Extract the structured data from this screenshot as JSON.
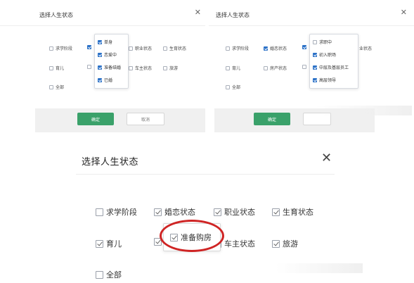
{
  "left_panel": {
    "title": "选择人生状态",
    "close_glyph": "✕",
    "options": {
      "study": "求学阶段",
      "career": "职业状态",
      "fertility": "生育状态",
      "parenting": "育儿",
      "car": "车主状态",
      "travel": "旅游",
      "all": "全部"
    },
    "dropdown": {
      "items": [
        "单身",
        "恋爱中",
        "准备结婚",
        "已婚"
      ]
    },
    "confirm_label": "确定",
    "cancel_label": "取消"
  },
  "right_panel": {
    "title": "选择人生状态",
    "close_glyph": "✕",
    "options": {
      "study": "求学阶段",
      "marriage": "婚恋状态",
      "career_trunc": "业状态",
      "parenting": "育儿",
      "property": "房产状态",
      "all": "全部"
    },
    "dropdown": {
      "items": [
        "求职中",
        "初入职场",
        "中层及基层员工",
        "高层领导"
      ]
    },
    "confirm_label": "确定"
  },
  "bottom_panel": {
    "title": "选择人生状态",
    "close_glyph": "✕",
    "options": {
      "study": "求学阶段",
      "marriage": "婚恋状态",
      "career": "职业状态",
      "fertility": "生育状态",
      "parenting": "育儿",
      "car": "车主状态",
      "travel": "旅游",
      "all": "全部"
    },
    "dropdown": {
      "item": "准备购房"
    }
  },
  "colors": {
    "accent_blue": "#2b71c7",
    "confirm_green": "#3aa16a",
    "highlight_red": "#cf2424"
  }
}
